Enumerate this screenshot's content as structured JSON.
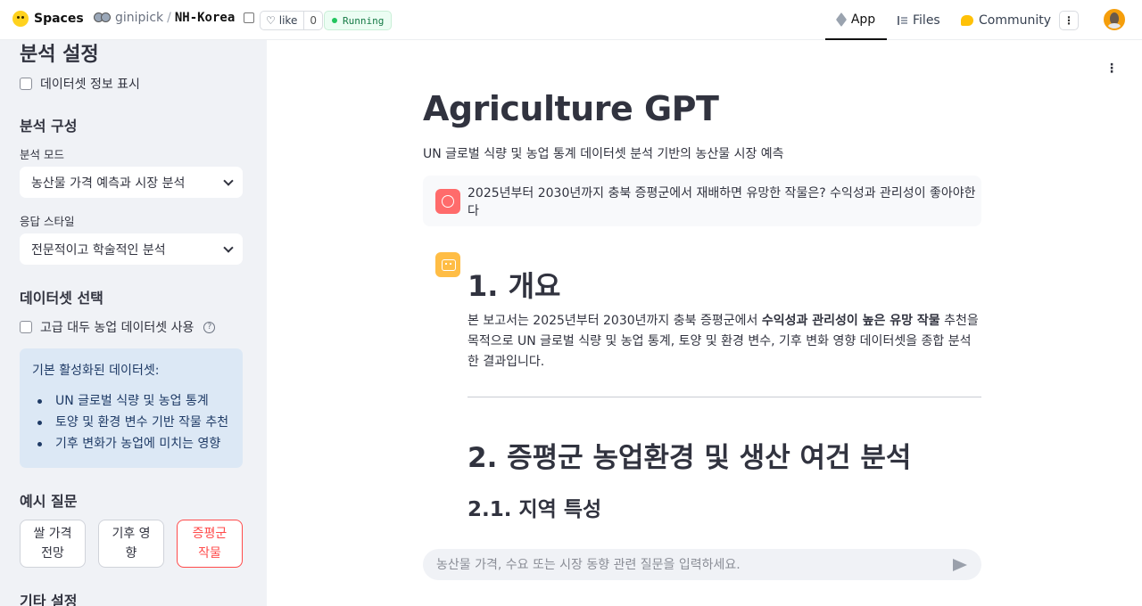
{
  "topbar": {
    "brand": "Spaces",
    "owner": "ginipick",
    "separator": "/",
    "repo": "NH-Korea",
    "like_label": "like",
    "like_count": "0",
    "status": "Running",
    "tabs": [
      {
        "label": "App",
        "icon": "cube-icon",
        "active": true
      },
      {
        "label": "Files",
        "icon": "files-icon"
      },
      {
        "label": "Community",
        "icon": "community-icon"
      }
    ],
    "more_label": "⋮"
  },
  "sidebar": {
    "heading": "분석 설정",
    "show_dataset_info": "데이터셋 정보 표시",
    "config_heading": "분석 구성",
    "mode_label": "분석 모드",
    "mode_value": "농산물 가격 예측과 시장 분석",
    "style_label": "응답 스타일",
    "style_value": "전문적이고 학술적인 분석",
    "dataset_heading": "데이터셋 선택",
    "advanced_dataset": "고급 대두 농업 데이터셋 사용",
    "info_box": {
      "title": "기본 활성화된 데이터셋:",
      "items": [
        "UN 글로벌 식량 및 농업 통계",
        "토양 및 환경 변수 기반 작물 추천",
        "기후 변화가 농업에 미치는 영향"
      ]
    },
    "examples_heading": "예시 질문",
    "examples": [
      {
        "line1": "쌀 가격",
        "line2": "전망"
      },
      {
        "line1": "기후 영",
        "line2": "향"
      },
      {
        "line1": "증평군",
        "line2": "작물"
      }
    ],
    "other_heading": "기타 설정"
  },
  "main": {
    "more_label": "⋮",
    "title": "Agriculture GPT",
    "subtitle": "UN 글로벌 식량 및 농업 통계 데이터셋 분석 기반의 농산물 시장 예측",
    "user_message": "2025년부터 2030년까지 충북 증평군에서 재배하면 유망한 작물은? 수익성과 관리성이 좋아야한다",
    "response": {
      "h1": "1. 개요",
      "para_before": "본 보고서는 2025년부터 2030년까지 충북 증평군에서 ",
      "para_bold": "수익성과 관리성이 높은 유망 작물",
      "para_after": " 추천을 목적으로 UN 글로벌 식량 및 농업 통계, 토양 및 환경 변수, 기후 변화 영향 데이터셋을 종합 분석한 결과입니다.",
      "h2": "2. 증평군 농업환경 및 생산 여건 분석",
      "h3": "2.1. 지역 특성"
    },
    "chat_placeholder": "농산물 가격, 수요 또는 시장 동향 관련 질문을 입력하세요."
  },
  "colors": {
    "sidebar_bg": "#f0f2f6",
    "accent_red": "#ff4b4b",
    "info_bg": "#dce8f5",
    "user_avatar": "#ff6b6b",
    "bot_avatar": "#ffbd45",
    "running_green": "#22c55e"
  }
}
